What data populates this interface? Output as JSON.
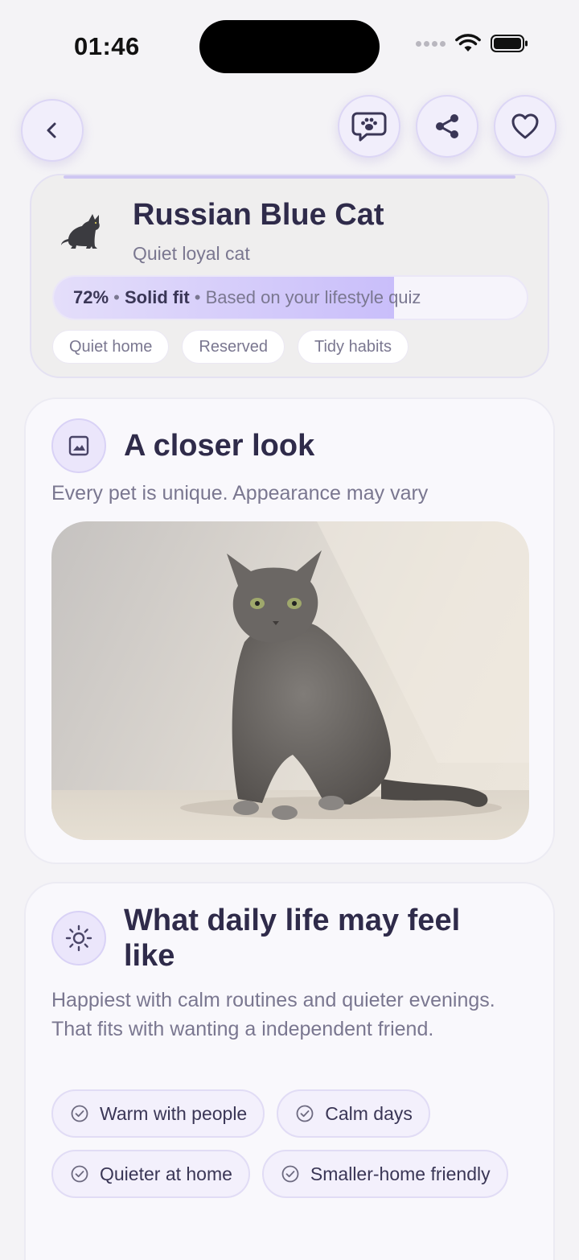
{
  "status_bar": {
    "time": "01:46"
  },
  "pet": {
    "name": "Russian Blue Cat",
    "subtitle": "Quiet loyal cat",
    "fit": {
      "percent_label": "72%",
      "percent": 72,
      "level": "Solid fit",
      "basis": "Based on your lifestyle quiz"
    },
    "tags": [
      "Quiet home",
      "Reserved",
      "Tidy habits"
    ]
  },
  "closer_look": {
    "title": "A closer look",
    "subtitle": "Every pet is unique. Appearance may vary"
  },
  "daily_life": {
    "title": "What daily life may feel like",
    "description": "Happiest with calm routines and quieter evenings. That fits with wanting a independent friend.",
    "chips": [
      "Warm with people",
      "Calm days",
      "Quieter at home",
      "Smaller-home friendly"
    ]
  },
  "colors": {
    "accent": "#c9befa",
    "title": "#2f2b4a",
    "muted": "#7a7790"
  }
}
